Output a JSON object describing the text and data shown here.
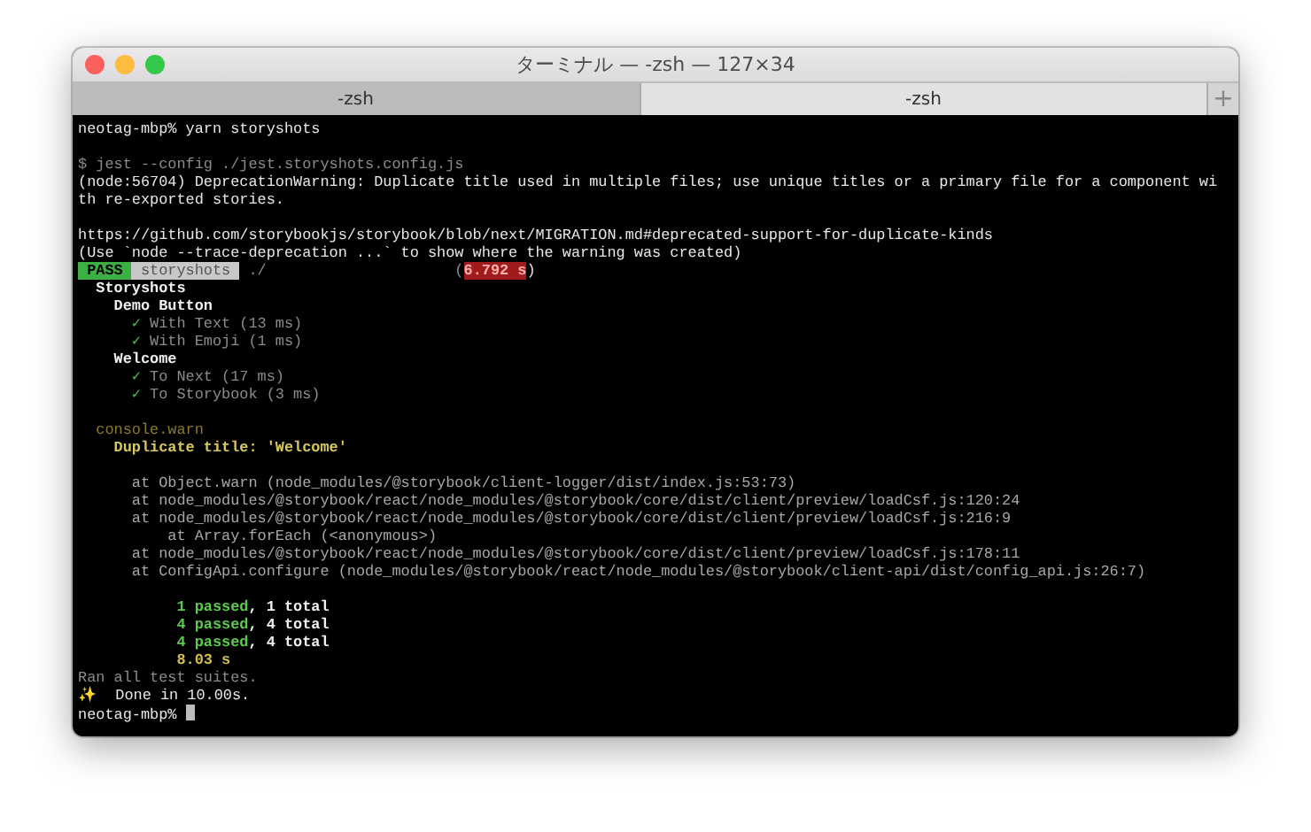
{
  "window": {
    "title": "ターミナル — -zsh — 127×34"
  },
  "tabs": [
    {
      "label": "-zsh",
      "selected": false
    },
    {
      "label": "-zsh",
      "selected": true
    }
  ],
  "new_tab": "+",
  "terminal": {
    "lines": [
      {
        "kind": "text",
        "segments": [
          {
            "text": "neotag-mbp% yarn storyshots",
            "kind": "plain"
          }
        ]
      },
      {
        "kind": "blank"
      },
      {
        "kind": "text",
        "segments": [
          {
            "text": "$ jest --config ./jest.storyshots.config.js",
            "kind": "dim"
          }
        ]
      },
      {
        "kind": "text",
        "segments": [
          {
            "text": "(node:56704) DeprecationWarning: Duplicate title used in multiple files; use unique titles or a primary file for a component wi",
            "kind": "plain"
          }
        ]
      },
      {
        "kind": "text",
        "segments": [
          {
            "text": "th re-exported stories.",
            "kind": "plain"
          }
        ]
      },
      {
        "kind": "blank"
      },
      {
        "kind": "text",
        "segments": [
          {
            "text": "https://github.com/storybookjs/storybook/blob/next/MIGRATION.md#deprecated-support-for-duplicate-kinds",
            "kind": "plain"
          }
        ]
      },
      {
        "kind": "text",
        "segments": [
          {
            "text": "(Use `node --trace-deprecation ...` to show where the warning was created)",
            "kind": "plain"
          }
        ]
      },
      {
        "kind": "text",
        "segments": [
          {
            "text": " PASS ",
            "kind": "pass"
          },
          {
            "text": " storyshots ",
            "kind": "badge"
          },
          {
            "text": " ./                     (",
            "kind": "dim"
          },
          {
            "text": "6.792 s",
            "kind": "slow"
          },
          {
            "text": ")",
            "kind": "plain"
          }
        ]
      },
      {
        "kind": "text",
        "segments": [
          {
            "text": "  Storyshots",
            "kind": "bold"
          }
        ]
      },
      {
        "kind": "text",
        "segments": [
          {
            "text": "    Demo Button",
            "kind": "bold"
          }
        ]
      },
      {
        "kind": "text",
        "segments": [
          {
            "text": "      ✓",
            "kind": "check"
          },
          {
            "text": " With Text (13 ms)",
            "kind": "dim"
          }
        ]
      },
      {
        "kind": "text",
        "segments": [
          {
            "text": "      ✓",
            "kind": "check"
          },
          {
            "text": " With Emoji (1 ms)",
            "kind": "dim"
          }
        ]
      },
      {
        "kind": "text",
        "segments": [
          {
            "text": "    Welcome",
            "kind": "bold"
          }
        ]
      },
      {
        "kind": "text",
        "segments": [
          {
            "text": "      ✓",
            "kind": "check"
          },
          {
            "text": " To Next (17 ms)",
            "kind": "dim"
          }
        ]
      },
      {
        "kind": "text",
        "segments": [
          {
            "text": "      ✓",
            "kind": "check"
          },
          {
            "text": " To Storybook (3 ms)",
            "kind": "dim"
          }
        ]
      },
      {
        "kind": "blank"
      },
      {
        "kind": "text",
        "segments": [
          {
            "text": "  console.warn",
            "kind": "dimyellow"
          }
        ]
      },
      {
        "kind": "text",
        "segments": [
          {
            "text": "    Duplicate title: 'Welcome'",
            "kind": "yellow"
          }
        ]
      },
      {
        "kind": "blank"
      },
      {
        "kind": "text",
        "segments": [
          {
            "text": "      at Object.warn (node_modules/@storybook/client-logger/dist/index.js:53:73)",
            "kind": "trace"
          }
        ]
      },
      {
        "kind": "text",
        "segments": [
          {
            "text": "      at node_modules/@storybook/react/node_modules/@storybook/core/dist/client/preview/loadCsf.js:120:24",
            "kind": "trace"
          }
        ]
      },
      {
        "kind": "text",
        "segments": [
          {
            "text": "      at node_modules/@storybook/react/node_modules/@storybook/core/dist/client/preview/loadCsf.js:216:9",
            "kind": "trace"
          }
        ]
      },
      {
        "kind": "text",
        "segments": [
          {
            "text": "          at Array.forEach (<anonymous>)",
            "kind": "trace"
          }
        ]
      },
      {
        "kind": "text",
        "segments": [
          {
            "text": "      at node_modules/@storybook/react/node_modules/@storybook/core/dist/client/preview/loadCsf.js:178:11",
            "kind": "trace"
          }
        ]
      },
      {
        "kind": "text",
        "segments": [
          {
            "text": "      at ConfigApi.configure (node_modules/@storybook/react/node_modules/@storybook/client-api/dist/config_api.js:26:7)",
            "kind": "trace"
          }
        ]
      },
      {
        "kind": "blank"
      },
      {
        "kind": "text",
        "segments": [
          {
            "text": "           1 passed",
            "kind": "green"
          },
          {
            "text": ", 1 total",
            "kind": "bold"
          }
        ]
      },
      {
        "kind": "text",
        "segments": [
          {
            "text": "           4 passed",
            "kind": "green"
          },
          {
            "text": ", 4 total",
            "kind": "bold"
          }
        ]
      },
      {
        "kind": "text",
        "segments": [
          {
            "text": "           4 passed",
            "kind": "green"
          },
          {
            "text": ", 4 total",
            "kind": "bold"
          }
        ]
      },
      {
        "kind": "text",
        "segments": [
          {
            "text": "           8.03 s",
            "kind": "yellowbold"
          }
        ]
      },
      {
        "kind": "text",
        "segments": [
          {
            "text": "Ran all test suites.",
            "kind": "dim"
          }
        ]
      },
      {
        "kind": "text",
        "segments": [
          {
            "text": "✨  Done in 10.00s.",
            "kind": "plain"
          }
        ]
      },
      {
        "kind": "prompt",
        "segments": [
          {
            "text": "neotag-mbp% ",
            "kind": "plain"
          }
        ]
      }
    ]
  }
}
